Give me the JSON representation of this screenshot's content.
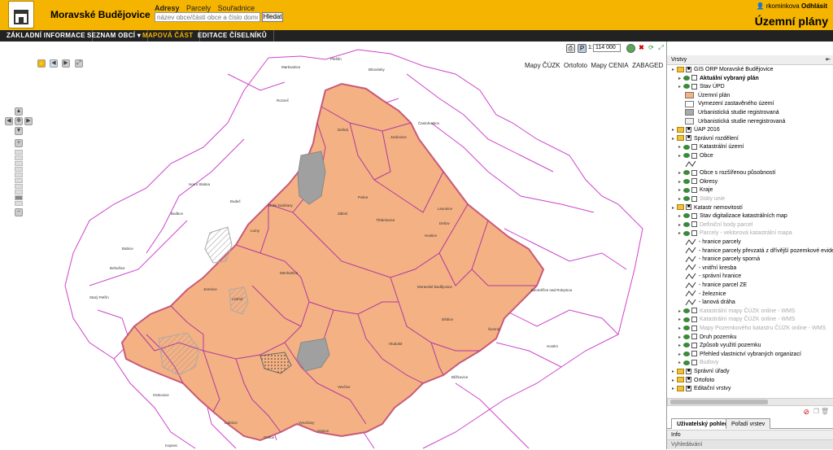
{
  "header": {
    "city_name": "Moravské Budějovice",
    "search_tabs": [
      "Adresy",
      "Parcely",
      "Souřadnice"
    ],
    "search_placeholder": "název obce/části obce a číslo domovní",
    "search_button": "Hledat",
    "username": "rkominkova",
    "logout": "Odhlásit",
    "app_title": "Územní plány"
  },
  "menu": [
    {
      "label": "ZÁKLADNÍ INFORMACE"
    },
    {
      "label": "SEZNAM OBCÍ ▾"
    },
    {
      "label": "MAPOVÁ ČÁST"
    },
    {
      "label": "EDITACE ČÍSELNÍKŮ"
    }
  ],
  "map": {
    "scale_prefix": "1:",
    "scale_value": "114 000",
    "basemaps": [
      "Mapy ČÚZK",
      "Ortofoto",
      "Mapy CENIA",
      "ZABAGED"
    ],
    "municipalities": [
      "Pleštín",
      "Bítovánky",
      "Markvartice",
      "Starý Petřín",
      "Jemnice",
      "Dešná",
      "Rozseč",
      "Lomy",
      "Dolní Dubňany",
      "Police",
      "Jackovice",
      "Častohostice",
      "Horní Slatina",
      "Budeč",
      "Budkov",
      "Moravské Budějovice",
      "Jaroměřice nad Rokytnou",
      "Litohoř",
      "Hostim",
      "Blížkovice",
      "Vranov",
      "Lesonice",
      "Šumná",
      "Hluboké",
      "Dědice",
      "Lubnice",
      "Vysočany",
      "Onšov",
      "Vevčice",
      "Kopnec",
      "Dešov",
      "Oslnovice",
      "Zálesí",
      "Třebelovice",
      "Hostice",
      "Babice",
      "Bohušice",
      "Menhartice"
    ]
  },
  "panel": {
    "title": "Vrstvy",
    "tree": [
      {
        "text": "GIS ORP Moravské Budějovice",
        "level": 0,
        "type": "folder"
      },
      {
        "text": "Aktuální vybraný plán",
        "level": 1,
        "type": "eye",
        "bold": true
      },
      {
        "text": "Stav ÚPD",
        "level": 1,
        "type": "eye"
      },
      {
        "text": "Územní plán",
        "level": 2,
        "type": "swatch",
        "color": "#f4b183"
      },
      {
        "text": "Vymezení zastavěného území",
        "level": 2,
        "type": "swatch",
        "color": "#ffffff"
      },
      {
        "text": "Urbanistická studie registrovaná",
        "level": 2,
        "type": "swatch",
        "color": "#aaaaaa"
      },
      {
        "text": "Urbanistická studie neregistrovaná",
        "level": 2,
        "type": "swatch",
        "color": "#eeeeee"
      },
      {
        "text": "ÚAP 2016",
        "level": 0,
        "type": "folder"
      },
      {
        "text": "Správní rozdělení",
        "level": 0,
        "type": "folder"
      },
      {
        "text": "Katastrální území",
        "level": 1,
        "type": "eye"
      },
      {
        "text": "Obce",
        "level": 1,
        "type": "eye"
      },
      {
        "text": "",
        "level": 2,
        "type": "line"
      },
      {
        "text": "Obce s rozšířenou působností",
        "level": 1,
        "type": "eye"
      },
      {
        "text": "Okresy",
        "level": 1,
        "type": "eye"
      },
      {
        "text": "Kraje",
        "level": 1,
        "type": "eye"
      },
      {
        "text": "Státy unie",
        "level": 1,
        "type": "eye",
        "dim": true
      },
      {
        "text": "Katastr nemovitostí",
        "level": 0,
        "type": "folder"
      },
      {
        "text": "Stav digitalizace katastrálních map",
        "level": 1,
        "type": "eye"
      },
      {
        "text": "Definiční body parcel",
        "level": 1,
        "type": "eye",
        "dim": true
      },
      {
        "text": "Parcely - vektorová katastrální mapa",
        "level": 1,
        "type": "eye",
        "dim": true
      },
      {
        "text": "- hranice parcely",
        "level": 2,
        "type": "line"
      },
      {
        "text": "- hranice parcely převzatá z dřívější pozemkové evidence",
        "level": 2,
        "type": "line"
      },
      {
        "text": "- hranice parcely sporná",
        "level": 2,
        "type": "line"
      },
      {
        "text": "- vnitřní kresba",
        "level": 2,
        "type": "line"
      },
      {
        "text": "- správní hranice",
        "level": 2,
        "type": "line"
      },
      {
        "text": "- hranice parcel ZE",
        "level": 2,
        "type": "line"
      },
      {
        "text": "- železnice",
        "level": 2,
        "type": "line"
      },
      {
        "text": "- lanová dráha",
        "level": 2,
        "type": "line"
      },
      {
        "text": "Katastrální mapy ČÚZK online - WMS",
        "level": 1,
        "type": "eye",
        "dim": true
      },
      {
        "text": "Katastrální mapy ČÚZK online - WMS",
        "level": 1,
        "type": "eye",
        "dim": true
      },
      {
        "text": "Mapy Pozemkového katastru ČÚZK online - WMS",
        "level": 1,
        "type": "eye",
        "dim": true
      },
      {
        "text": "Druh pozemku",
        "level": 1,
        "type": "eye"
      },
      {
        "text": "Způsob využití pozemku",
        "level": 1,
        "type": "eye"
      },
      {
        "text": "Přehled vlastnictví vybraných organizací",
        "level": 1,
        "type": "eye"
      },
      {
        "text": "Budovy",
        "level": 1,
        "type": "eye",
        "dim": true
      },
      {
        "text": "Správní úřady",
        "level": 0,
        "type": "folder"
      },
      {
        "text": "Ortofoto",
        "level": 0,
        "type": "folder"
      },
      {
        "text": "Editační vrstvy",
        "level": 0,
        "type": "folder"
      }
    ],
    "tabs": [
      "Uživatelský pohled",
      "Pořadí vrstev"
    ],
    "info_label": "Info",
    "search_label": "Vyhledávání"
  }
}
